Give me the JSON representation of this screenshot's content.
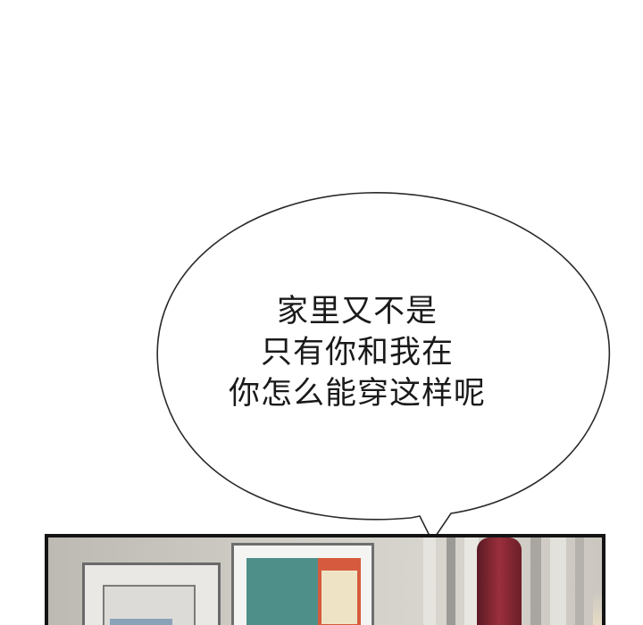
{
  "speech_bubble": {
    "lines": [
      "家里又不是",
      "只有你和我在",
      "你怎么能穿这样呢"
    ]
  },
  "panel": {
    "accent_colors": {
      "frame_art_teal": "#4f8f8a",
      "frame_art_red": "#d65b3e",
      "figure_dark_red": "#9a2f3c"
    }
  }
}
